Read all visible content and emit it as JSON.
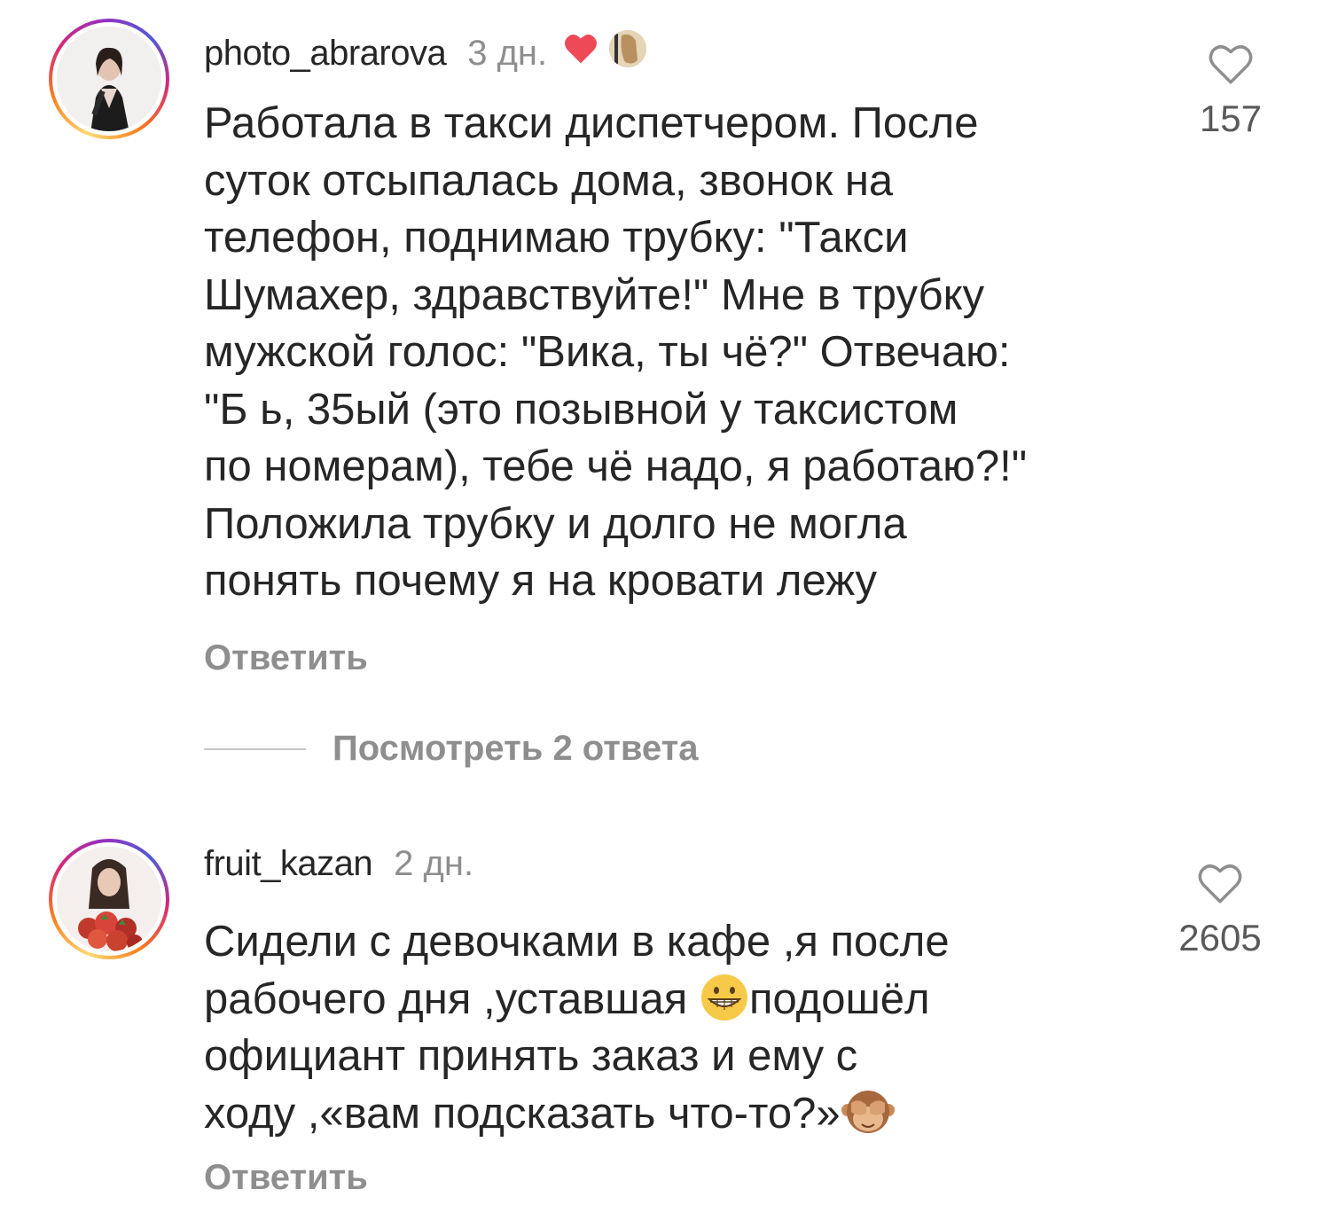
{
  "comments": [
    {
      "username": "photo_abrarova",
      "time": "3 дн.",
      "text": "Работала в такси диспетчером. После\nсуток отсыпалась дома, звонок на\nтелефон, поднимаю трубку: \"Такси\nШумахер, здравствуйте!\" Мне в трубку\nмужской голос: \"Вика, ты чё?\" Отвечаю:\n\"Б       ь, 35ый (это позывной у таксистом\nпо номерам), тебе чё надо, я работаю?!\"\nПоложила трубку и долго не могла\nпонять почему я на кровати лежу",
      "likes": "157",
      "reply_label": "Ответить",
      "view_replies_label": "Посмотреть 2 ответа",
      "liked_by_author": true
    },
    {
      "username": "fruit_kazan",
      "time": "2 дн.",
      "text_part1": "Сидели с девочками в кафе ,я после\nрабочего дня ,уставшая ",
      "text_part2": "подошёл\nофициант принять заказ и ему с\nходу ,«вам подсказать что-то?»",
      "emoji_grin": "grinning-face-emoji",
      "emoji_monkey": "see-no-evil-monkey-emoji",
      "likes": "2605",
      "reply_label": "Ответить"
    }
  ],
  "colors": {
    "text": "#262626",
    "muted": "#8e8e8e",
    "author_heart": "#ed4956"
  }
}
